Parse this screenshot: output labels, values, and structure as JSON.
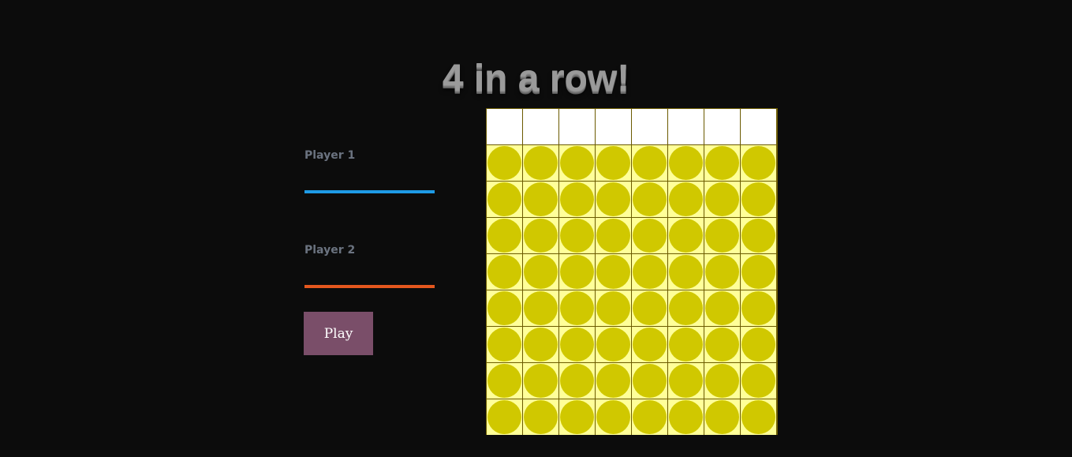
{
  "title": "4 in a row!",
  "player1": {
    "label": "Player 1",
    "value": "",
    "color": "#1e9be6"
  },
  "player2": {
    "label": "Player 2",
    "value": "",
    "color": "#e4571e"
  },
  "play_button": {
    "label": "Play",
    "color": "#7a4e69"
  },
  "board": {
    "columns": 8,
    "rows": 8,
    "drop_row_color": "#ffffff",
    "cell_color": "#ffff99",
    "slot_color": "#d0c800",
    "grid_line_color": "#6b5a00"
  }
}
